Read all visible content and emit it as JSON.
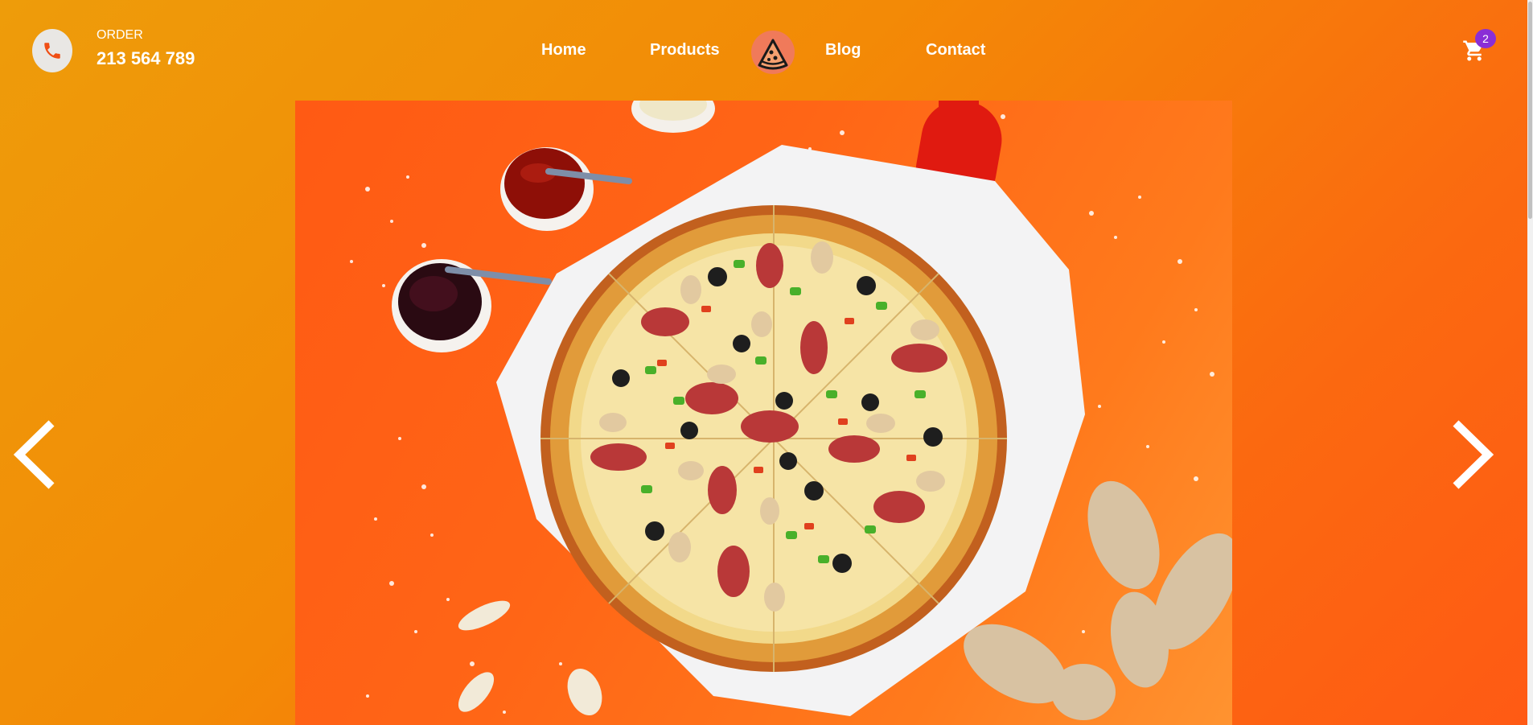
{
  "header": {
    "order_label": "ORDER",
    "order_phone": "213 564 789",
    "phone_icon": "phone-icon",
    "nav": [
      {
        "label": "Home"
      },
      {
        "label": "Products"
      },
      {
        "label": "Blog"
      },
      {
        "label": "Contact"
      }
    ],
    "logo_icon": "pizza-slice-logo-icon",
    "cart_icon": "shopping-cart-icon",
    "cart_count": "2"
  },
  "slider": {
    "image": "pizza-hero-image",
    "prev_icon": "chevron-left-icon",
    "next_icon": "chevron-right-icon"
  },
  "colors": {
    "gradient_start": "#ee9c0a",
    "gradient_end": "#ff5a14",
    "phone_icon": "#f04e14",
    "badge": "#8a2ed6",
    "text": "#ffffff"
  }
}
